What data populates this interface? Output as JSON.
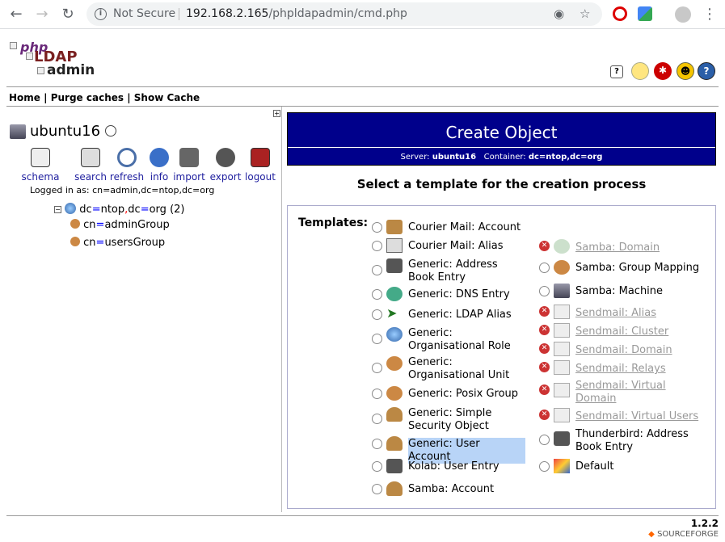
{
  "browser": {
    "security": "Not Secure",
    "url_host": "192.168.2.165",
    "url_path": "/phpldapadmin/cmd.php"
  },
  "logo": {
    "line1": "php",
    "line2": "LDAP",
    "line3": "admin"
  },
  "topnav": {
    "home": "Home",
    "sep": "|",
    "purge": "Purge caches",
    "show": "Show Cache"
  },
  "server": {
    "name": "ubuntu16",
    "logged_in": "Logged in as: cn=admin,dc=ntop,dc=org"
  },
  "actions": [
    {
      "label": "schema"
    },
    {
      "label": "search"
    },
    {
      "label": "refresh"
    },
    {
      "label": "info"
    },
    {
      "label": "import"
    },
    {
      "label": "export"
    },
    {
      "label": "logout"
    }
  ],
  "tree": {
    "root_a": "dc",
    "eq": "=",
    "root_b": "ntop",
    "comma": ",",
    "root_c": "dc",
    "root_d": "org",
    "root_count": "(2)",
    "children": [
      {
        "a": "cn",
        "b": "adminGroup"
      },
      {
        "a": "cn",
        "b": "usersGroup"
      }
    ]
  },
  "main": {
    "title": "Create Object",
    "server_label": "Server:",
    "server_value": "ubuntu16",
    "container_label": "Container:",
    "container_value": "dc=ntop,dc=org",
    "subtitle": "Select a template for the creation process",
    "templates_label": "Templates:"
  },
  "templates_left": [
    {
      "label": "Courier Mail: Account"
    },
    {
      "label": "Courier Mail: Alias"
    },
    {
      "label": "Generic: Address Book Entry"
    },
    {
      "label": "Generic: DNS Entry"
    },
    {
      "label": "Generic: LDAP Alias"
    },
    {
      "label": "Generic: Organisational Role"
    },
    {
      "label": "Generic: Organisational Unit"
    },
    {
      "label": "Generic: Posix Group"
    },
    {
      "label": "Generic: Simple Security Object"
    },
    {
      "label": "Generic: User Account"
    },
    {
      "label": "Kolab: User Entry"
    },
    {
      "label": "Samba: Account"
    }
  ],
  "templates_right": [
    {
      "label": "Samba: Domain",
      "disabled": true
    },
    {
      "label": "Samba: Group Mapping",
      "disabled": false
    },
    {
      "label": "Samba: Machine",
      "disabled": false
    },
    {
      "label": "Sendmail: Alias",
      "disabled": true
    },
    {
      "label": "Sendmail: Cluster",
      "disabled": true
    },
    {
      "label": "Sendmail: Domain",
      "disabled": true
    },
    {
      "label": "Sendmail: Relays",
      "disabled": true
    },
    {
      "label": "Sendmail: Virtual Domain",
      "disabled": true
    },
    {
      "label": "Sendmail: Virtual Users",
      "disabled": true
    },
    {
      "label": "Thunderbird: Address Book Entry",
      "disabled": false
    },
    {
      "label": "Default",
      "disabled": false
    }
  ],
  "footer": {
    "version": "1.2.2",
    "sourceforge": "SOURCEFORGE"
  }
}
